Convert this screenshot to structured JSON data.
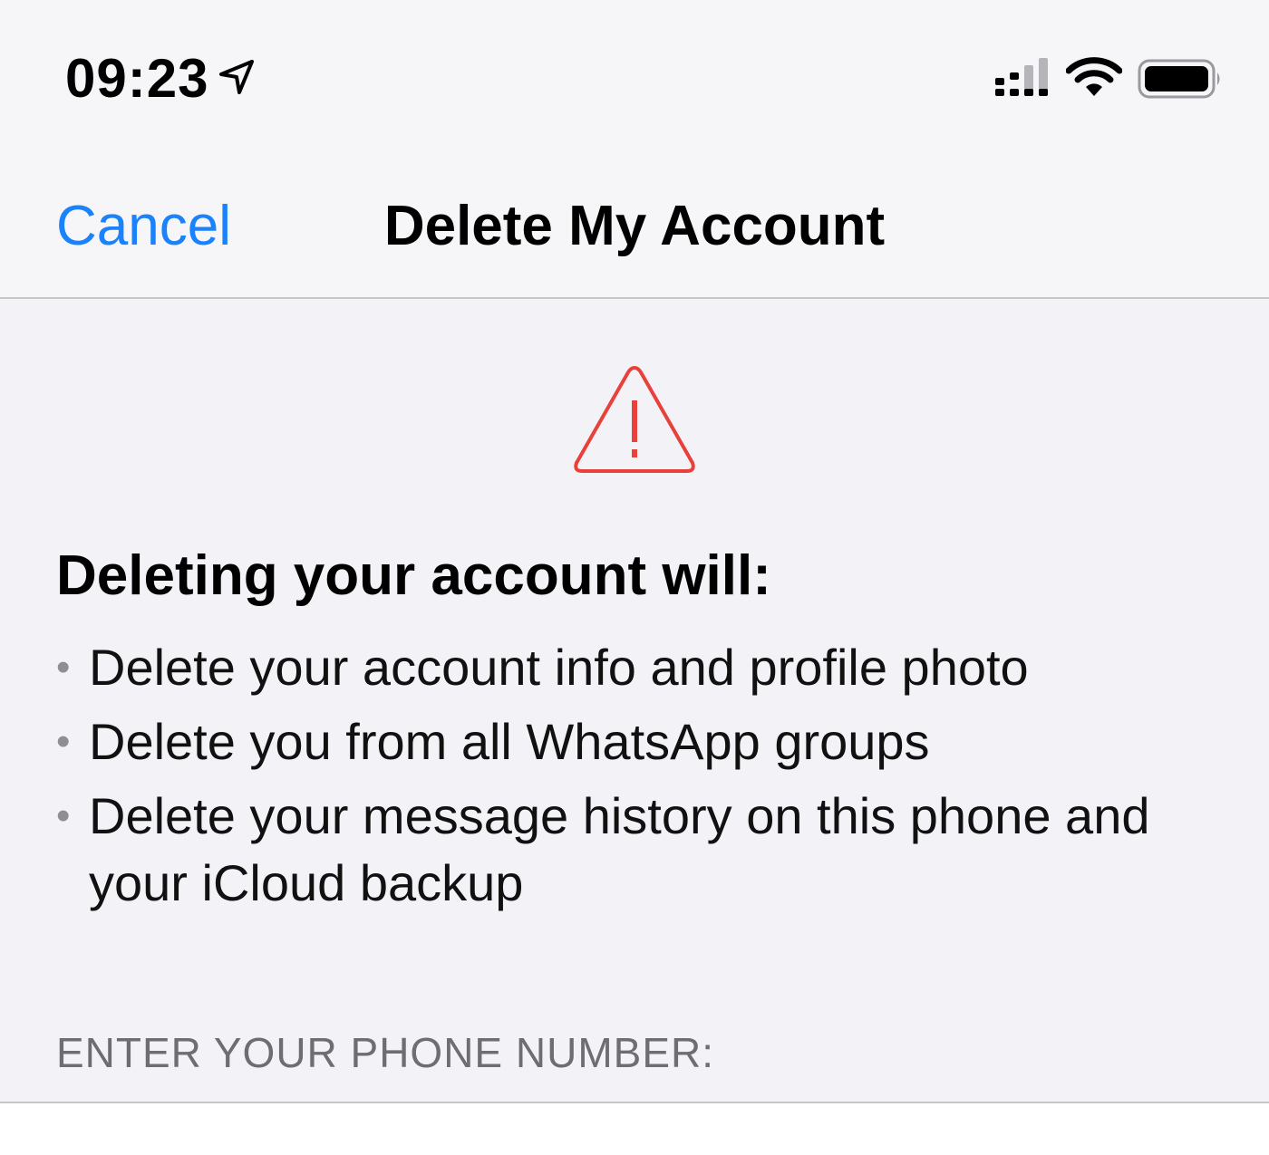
{
  "status_bar": {
    "time": "09:23",
    "icons": [
      "location-arrow-icon",
      "cellular-signal-icon",
      "wifi-icon",
      "battery-icon"
    ]
  },
  "nav": {
    "cancel_label": "Cancel",
    "title": "Delete My Account"
  },
  "warning": {
    "icon": "warning-triangle-icon",
    "color": "#e8413c"
  },
  "content": {
    "heading": "Deleting your account will:",
    "bullets": [
      "Delete your account info and profile photo",
      "Delete you from all WhatsApp groups",
      "Delete your message history on this phone and your iCloud backup"
    ]
  },
  "phone_section": {
    "label": "ENTER YOUR PHONE NUMBER:"
  },
  "colors": {
    "accent": "#1a82fb",
    "background": "#f2f2f7",
    "warning": "#e8413c"
  }
}
